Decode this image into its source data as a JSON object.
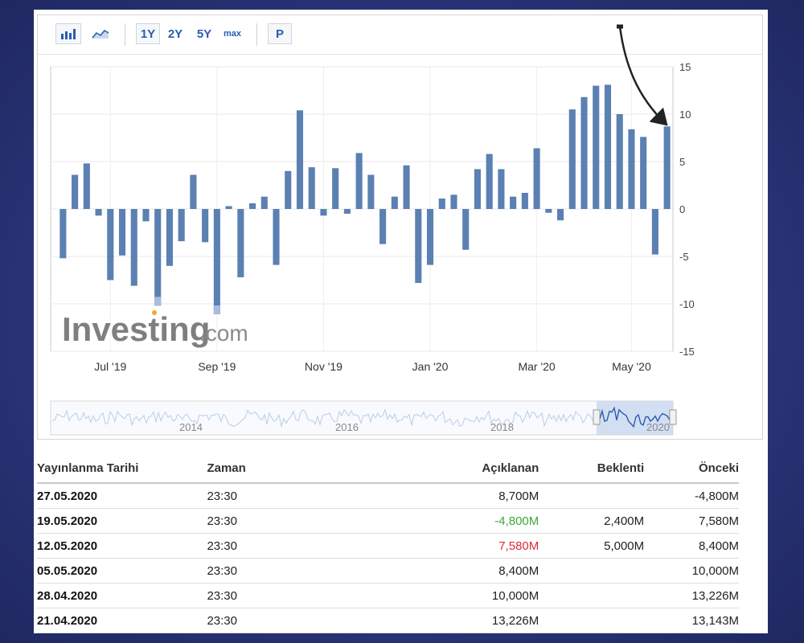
{
  "toolbar": {
    "ranges": [
      "1Y",
      "2Y",
      "5Y",
      "max"
    ],
    "p_label": "P"
  },
  "chart_data": {
    "type": "bar",
    "y_ticks": [
      "15",
      "10",
      "5",
      "0",
      "-5",
      "-10",
      "-15"
    ],
    "ylim": [
      -15,
      15
    ],
    "x_tick_labels": [
      "Jul '19",
      "Sep '19",
      "Nov '19",
      "Jan '20",
      "Mar '20",
      "May '20"
    ],
    "values": [
      -5.2,
      3.6,
      4.8,
      -0.7,
      -7.5,
      -4.9,
      -8.1,
      -1.3,
      -10.2,
      -6.0,
      -3.4,
      3.6,
      -3.5,
      -11.1,
      0.3,
      -7.2,
      0.6,
      1.3,
      -5.9,
      4.0,
      10.4,
      4.4,
      -0.7,
      4.3,
      -0.5,
      5.9,
      3.6,
      -3.7,
      1.3,
      4.6,
      -7.8,
      -5.9,
      1.1,
      1.5,
      -4.3,
      4.2,
      5.8,
      4.2,
      1.3,
      1.7,
      6.4,
      -0.4,
      -1.2,
      10.5,
      11.8,
      13.0,
      13.1,
      10.0,
      8.4,
      7.6,
      -4.8,
      8.7
    ],
    "navigator_labels": [
      "2014",
      "2016",
      "2018",
      "2020"
    ],
    "watermark_main": "Investing",
    "watermark_suffix": ".com",
    "bar_color": "#5b80b2",
    "highlight_color": "#a9bcdb"
  },
  "table": {
    "headers": [
      "Yayınlanma Tarihi",
      "Zaman",
      "Açıklanan",
      "Beklenti",
      "Önceki"
    ],
    "rows": [
      {
        "date": "27.05.2020",
        "time": "23:30",
        "actual": "8,700M",
        "actual_state": "",
        "forecast": "",
        "previous": "-4,800M"
      },
      {
        "date": "19.05.2020",
        "time": "23:30",
        "actual": "-4,800M",
        "actual_state": "pos",
        "forecast": "2,400M",
        "previous": "7,580M"
      },
      {
        "date": "12.05.2020",
        "time": "23:30",
        "actual": "7,580M",
        "actual_state": "neg",
        "forecast": "5,000M",
        "previous": "8,400M"
      },
      {
        "date": "05.05.2020",
        "time": "23:30",
        "actual": "8,400M",
        "actual_state": "",
        "forecast": "",
        "previous": "10,000M"
      },
      {
        "date": "28.04.2020",
        "time": "23:30",
        "actual": "10,000M",
        "actual_state": "",
        "forecast": "",
        "previous": "13,226M"
      },
      {
        "date": "21.04.2020",
        "time": "23:30",
        "actual": "13,226M",
        "actual_state": "",
        "forecast": "",
        "previous": "13,143M"
      }
    ]
  }
}
